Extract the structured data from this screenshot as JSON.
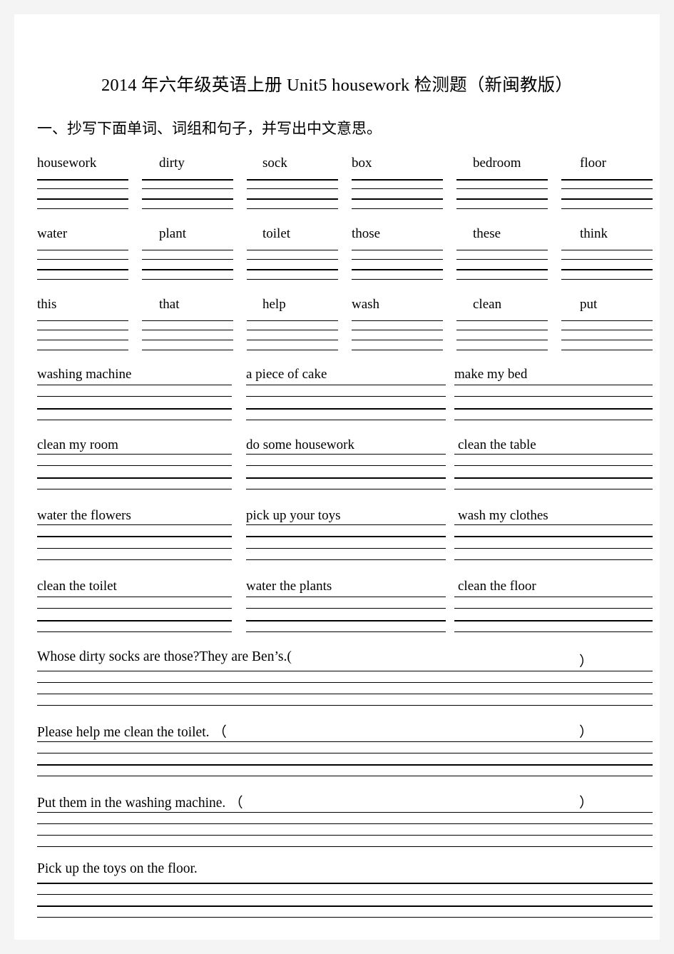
{
  "document": {
    "title": "2014 年六年级英语上册 Unit5  housework 检测题（新闽教版）",
    "section_heading": "一、抄写下面单词、词组和句子，并写出中文意思。"
  },
  "word_rows": [
    {
      "words": [
        "housework",
        "dirty",
        "sock",
        "box",
        "bedroom",
        "floor"
      ]
    },
    {
      "words": [
        "water",
        "plant",
        "toilet",
        "those",
        "these",
        "think"
      ]
    },
    {
      "words": [
        "this",
        "that",
        "help",
        "wash",
        "clean",
        "put"
      ]
    }
  ],
  "phrase_rows": [
    {
      "phrases": [
        "washing machine",
        "a piece of cake",
        "make my bed"
      ]
    },
    {
      "phrases": [
        "clean my room",
        "do some housework",
        "clean the table"
      ]
    },
    {
      "phrases": [
        "water the flowers",
        "pick up your toys",
        "wash my clothes"
      ]
    },
    {
      "phrases": [
        "clean the toilet",
        "water the plants",
        "clean the floor"
      ]
    }
  ],
  "sentence_rows": [
    {
      "text": "Whose  dirty  socks  are  those?They  are  Ben’s.(",
      "close_paren": "）"
    },
    {
      "text": "Please  help  me  clean  the  toilet.                （",
      "close_paren": "）"
    },
    {
      "text": "Put  them  in  the  washing  machine.                （",
      "close_paren": "）"
    },
    {
      "text": "Pick  up  the  toys  on  the  floor.",
      "close_paren": ""
    }
  ]
}
